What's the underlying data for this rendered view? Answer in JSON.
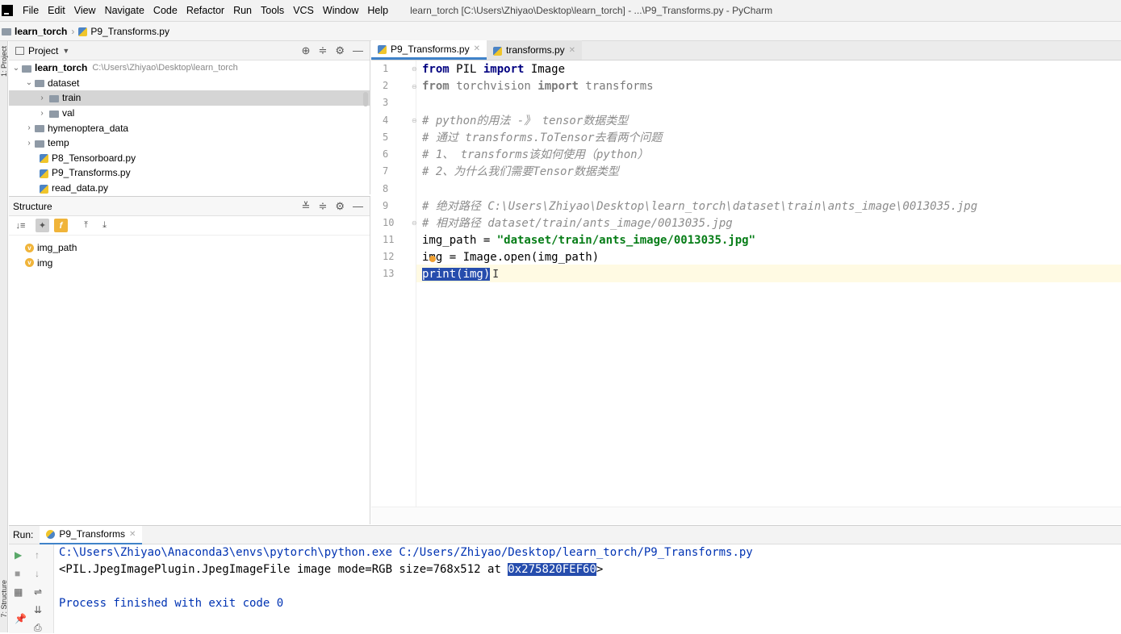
{
  "menu": {
    "items": [
      "File",
      "Edit",
      "View",
      "Navigate",
      "Code",
      "Refactor",
      "Run",
      "Tools",
      "VCS",
      "Window",
      "Help"
    ],
    "window_title": "learn_torch [C:\\Users\\Zhiyao\\Desktop\\learn_torch] - ...\\P9_Transforms.py - PyCharm"
  },
  "breadcrumb": {
    "root": "learn_torch",
    "file": "P9_Transforms.py"
  },
  "side_strip": {
    "project_tab": "1: Project",
    "structure_tab": "7: Structure"
  },
  "project": {
    "header": "Project",
    "root_name": "learn_torch",
    "root_path": "C:\\Users\\Zhiyao\\Desktop\\learn_torch",
    "nodes": [
      "dataset",
      "train",
      "val",
      "hymenoptera_data",
      "temp",
      "P8_Tensorboard.py",
      "P9_Transforms.py",
      "read_data.py"
    ]
  },
  "structure": {
    "header": "Structure",
    "items": [
      "img_path",
      "img"
    ]
  },
  "editor": {
    "tabs": [
      {
        "label": "P9_Transforms.py",
        "active": true
      },
      {
        "label": "transforms.py",
        "active": false
      }
    ],
    "line_numbers": [
      "1",
      "2",
      "3",
      "4",
      "5",
      "6",
      "7",
      "8",
      "9",
      "10",
      "11",
      "12",
      "13"
    ],
    "code": {
      "l1_from": "from",
      "l1_mod": " PIL ",
      "l1_import": "import",
      "l1_name": " Image",
      "l2_from": "from",
      "l2_mod": " torchvision ",
      "l2_import": "import",
      "l2_name": " transforms",
      "l4": "# python的用法 -》 tensor数据类型",
      "l5": "# 通过 transforms.ToTensor去看两个问题",
      "l6": "# 1、 transforms该如何使用（python）",
      "l7": "# 2、为什么我们需要Tensor数据类型",
      "l9": "# 绝对路径 C:\\Users\\Zhiyao\\Desktop\\learn_torch\\dataset\\train\\ants_image\\0013035.jpg",
      "l10": "# 相对路径 dataset/train/ants_image/0013035.jpg",
      "l11_var": "img_path = ",
      "l11_str": "\"dataset/train/ants_image/0013035.jpg\"",
      "l12": "img = Image.open(img_path)",
      "l13": "print(img)"
    }
  },
  "run": {
    "label": "Run:",
    "tab": "P9_Transforms",
    "output": {
      "cmd": "C:\\Users\\Zhiyao\\Anaconda3\\envs\\pytorch\\python.exe C:/Users/Zhiyao/Desktop/learn_torch/P9_Transforms.py",
      "result_prefix": "<PIL.JpegImagePlugin.JpegImageFile image mode=RGB size=768x512 at ",
      "result_addr": "0x275820FEF60",
      "result_suffix": ">",
      "finished": "Process finished with exit code 0"
    }
  },
  "colors": {
    "accent": "#4083c9",
    "selection": "#264dad",
    "keyword": "#000080",
    "string": "#067d17",
    "current_line": "#fffae3"
  }
}
